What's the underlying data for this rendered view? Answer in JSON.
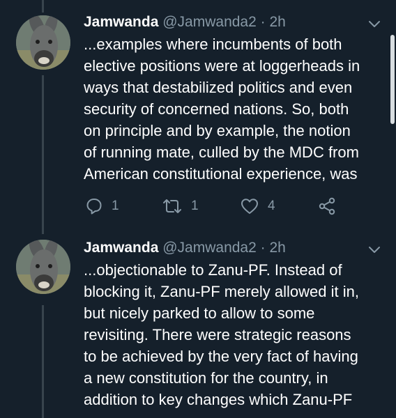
{
  "tweets": [
    {
      "name": "Jamwanda",
      "handle": "@Jamwanda2",
      "separator": "·",
      "time": "2h",
      "lines": [
        "...examples where incumbents of both",
        "elective positions were at loggerheads in",
        "ways that destabilized politics and even",
        "security of concerned nations. So, both",
        "on principle and by example, the notion",
        "of running mate, culled by the MDC from",
        "American constitutional experience, was"
      ],
      "reply_count": "1",
      "retweet_count": "1",
      "like_count": "4"
    },
    {
      "name": "Jamwanda",
      "handle": "@Jamwanda2",
      "separator": "·",
      "time": "2h",
      "lines": [
        "...objectionable to Zanu-PF. Instead of",
        "blocking it, Zanu-PF merely allowed it in,",
        "but nicely parked to allow to some",
        "revisiting. There were strategic reasons",
        "to be achieved by the very fact of having",
        "a new constitution for the country, in",
        "addition to key changes which Zanu-PF"
      ]
    }
  ],
  "icons": {
    "reply": "reply-icon",
    "retweet": "retweet-icon",
    "like": "heart-icon",
    "share": "share-icon",
    "menu": "chevron-down-icon"
  },
  "colors": {
    "background": "#15202b",
    "text": "#ffffff",
    "secondary": "#8899a6",
    "thread_line": "#38444d"
  }
}
